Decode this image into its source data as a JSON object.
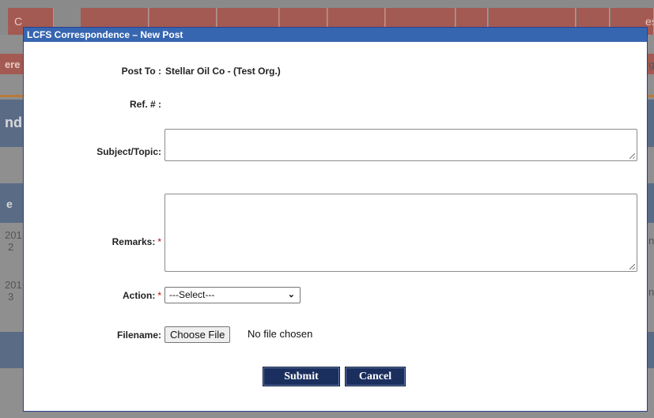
{
  "background": {
    "tab_fragments": [
      "C",
      "es"
    ],
    "text_fragments": [
      "ere",
      "rg",
      "nd",
      "e",
      "201",
      "2",
      "201",
      "3",
      "n",
      "n"
    ]
  },
  "dialog": {
    "title": "LCFS Correspondence – New Post",
    "post_to_label": "Post To :",
    "post_to_value": "Stellar Oil Co - (Test Org.)",
    "ref_label": "Ref. # :",
    "ref_value": "",
    "subject_label": "Subject/Topic:",
    "subject_value": "",
    "remarks_label": "Remarks:",
    "remarks_value": "",
    "required_marker": "*",
    "action_label": "Action:",
    "action_selected": "---Select---",
    "filename_label": "Filename:",
    "file_button_label": "Choose File",
    "file_status": "No file chosen",
    "submit_label": "Submit",
    "cancel_label": "Cancel"
  },
  "colors": {
    "titlebar": "#3766b1",
    "button": "#1b2f5e",
    "required": "#cc0000"
  }
}
